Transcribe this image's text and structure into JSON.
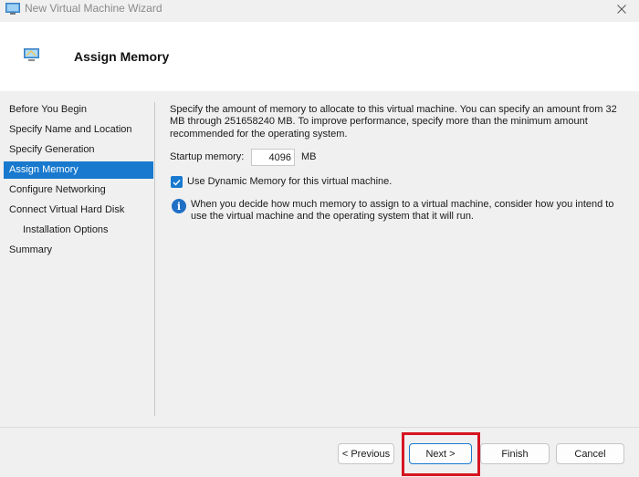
{
  "window": {
    "title": "New Virtual Machine Wizard"
  },
  "header": {
    "title": "Assign Memory",
    "icon": "monitor-icon"
  },
  "nav": {
    "items": [
      {
        "label": "Before You Begin"
      },
      {
        "label": "Specify Name and Location"
      },
      {
        "label": "Specify Generation"
      },
      {
        "label": "Assign Memory",
        "active": true
      },
      {
        "label": "Configure Networking"
      },
      {
        "label": "Connect Virtual Hard Disk"
      },
      {
        "label": "Installation Options"
      },
      {
        "label": "Summary"
      }
    ]
  },
  "content": {
    "description": "Specify the amount of memory to allocate to this virtual machine. You can specify an amount from 32 MB through 251658240 MB. To improve performance, specify more than the minimum amount recommended for the operating system.",
    "startup_memory_label": "Startup memory:",
    "startup_memory_value": "4096",
    "startup_memory_unit": "MB",
    "dynamic_memory_label": "Use Dynamic Memory for this virtual machine.",
    "dynamic_memory_checked": true,
    "info_text": "When you decide how much memory to assign to a virtual machine, consider how you intend to use the virtual machine and the operating system that it will run."
  },
  "footer": {
    "previous_label": "< Previous",
    "next_label": "Next >",
    "finish_label": "Finish",
    "cancel_label": "Cancel"
  },
  "colors": {
    "accent": "#1879ce",
    "highlight": "#d61521"
  }
}
